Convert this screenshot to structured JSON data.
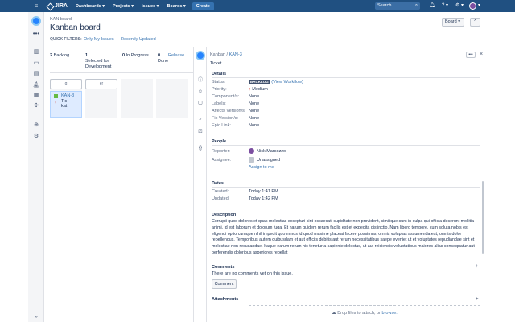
{
  "topnav": {
    "logo": "JIRA",
    "items": [
      "Dashboards ▾",
      "Projects ▾",
      "Issues ▾",
      "Boards ▾"
    ],
    "create": "Create",
    "search_placeholder": "Search",
    "help_icon": "?",
    "notifications_icon": "bell",
    "settings_icon": "gear"
  },
  "header": {
    "breadcrumb": "KAN board",
    "title": "Kanban board",
    "quick_filters_label": "QUICK FILTERS:",
    "quick_filters": [
      "Only My Issues",
      "Recently Updated"
    ],
    "board_button": "Board ▾",
    "more_button": "^"
  },
  "board": {
    "columns": [
      {
        "count": "2",
        "name": "Backlog"
      },
      {
        "count": "1",
        "name": "Selected for Development"
      },
      {
        "count": "0",
        "name": "In Progress"
      },
      {
        "count": "0",
        "name": "Done"
      }
    ],
    "release_link": "Release...",
    "column_tops": [
      "g",
      "er"
    ],
    "card": {
      "key": "KAN-3",
      "summary_line1": "Tic",
      "summary_line2": "kat"
    }
  },
  "detail": {
    "breadcrumb_project": "Kanban",
    "breadcrumb_sep": "/",
    "breadcrumb_key": "KAN-3",
    "issue_type": "Ticket",
    "more": "•••",
    "close": "×",
    "details_title": "Details",
    "fields": [
      {
        "label": "Status:",
        "value": "BACKLOG",
        "extra": "(View Workflow)"
      },
      {
        "label": "Priority:",
        "value": "Medium"
      },
      {
        "label": "Component/s:",
        "value": "None"
      },
      {
        "label": "Labels:",
        "value": "None"
      },
      {
        "label": "Affects Version/s:",
        "value": "None"
      },
      {
        "label": "Fix Version/s:",
        "value": "None"
      },
      {
        "label": "Epic Link:",
        "value": "None"
      }
    ],
    "people_title": "People",
    "reporter_label": "Reporter:",
    "reporter": "Nick Marsozzo",
    "assignee_label": "Assignee:",
    "assignee": "Unassigned",
    "assign_to_me": "Assign to me",
    "dates_title": "Dates",
    "created_label": "Created:",
    "created": "Today 1:41 PM",
    "updated_label": "Updated:",
    "updated": "Today 1:42 PM",
    "description_title": "Description",
    "description": "Corrupti quos dolores et quas molestias excepturi sint occaecati cupiditate non provident, similique sunt in culpa qui officia deserunt mollitia animi, id est laborum et dolorum fuga. Et harum quidem rerum facilis est et expedita distinctio. Nam libero tempore, cum soluta nobis est eligendi optio cumque nihil impedit quo minus id quod maxime placeat facere possimus, omnis voluptas assumenda est, omnis dolor repellendus. Temporibus autem quibusdam et aut officiis debitis aut rerum necessitatibus saepe eveniet ut et voluptates repudiandae sint et molestiae non recusandae. Itaque earum rerum hic tenetur a sapiente delectus, ut aut reiciendis voluptatibus maiores alias consequatur aut perferendis doloribus asperiores repellat",
    "comments_title": "Comments",
    "no_comments": "There are no comments yet on this issue.",
    "comment_button": "Comment",
    "attachments_title": "Attachments",
    "drop_text": "Drop files to attach, or",
    "browse": "browse."
  }
}
